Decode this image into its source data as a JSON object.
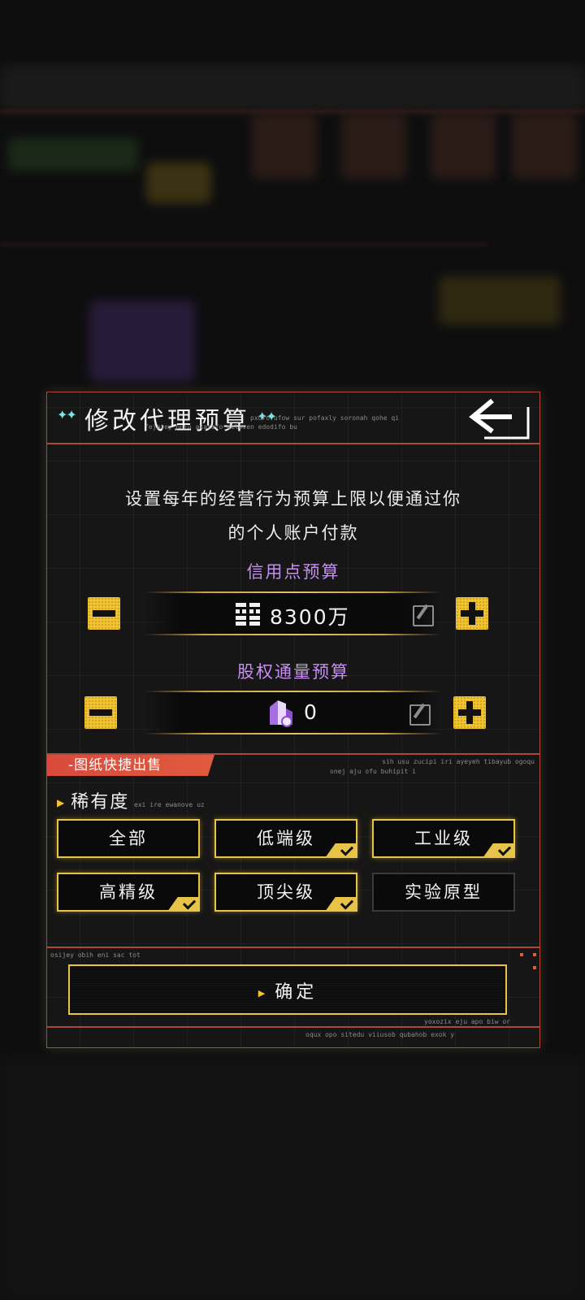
{
  "dialog": {
    "title": "修改代理预算",
    "subtitle_line1": "pxofo ufow sur pofaxly soronah qohe qi",
    "subtitle_line2": "fejatey puiu axarafo deloven edodifo bu",
    "description_line1": "设置每年的经营行为预算上限以便通过你",
    "description_line2": "的个人账户付款"
  },
  "credit": {
    "label": "信用点预算",
    "value": "8300万",
    "icon": "credit-chip-icon"
  },
  "equity": {
    "label": "股权通量预算",
    "value": "0",
    "icon": "equity-crystal-icon"
  },
  "quick_sell": {
    "tag": "-图纸快捷出售",
    "note_line1": "sih usu zucipi iri ayeyeh tibayub ogoqu",
    "note_line2": "onej aju ofu buhipit i",
    "rarity_label": "稀有度",
    "rarity_note": "exi ire ewanove uz",
    "options": [
      {
        "label": "全部",
        "selected": true,
        "checked": false
      },
      {
        "label": "低端级",
        "selected": true,
        "checked": true
      },
      {
        "label": "工业级",
        "selected": true,
        "checked": true
      },
      {
        "label": "高精级",
        "selected": true,
        "checked": true
      },
      {
        "label": "顶尖级",
        "selected": true,
        "checked": true
      },
      {
        "label": "实验原型",
        "selected": false,
        "checked": false
      }
    ]
  },
  "footer": {
    "note_top": "osijey obih eni sac tot",
    "confirm_label": "确定",
    "note_right": "yoxozix eju apo biw or",
    "note_bottom": "oqux opo sitedu viiusob qubahob exok y"
  },
  "colors": {
    "accent": "#f2c230",
    "border": "#b0473c",
    "purple": "#c58ef0",
    "tag": "#d94a3c"
  }
}
